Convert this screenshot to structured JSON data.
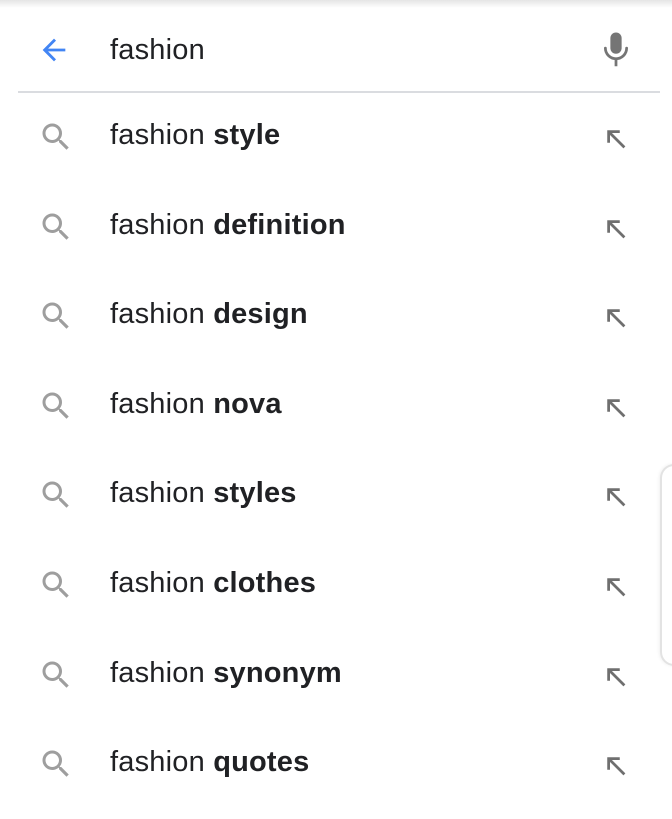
{
  "search": {
    "query": "fashion"
  },
  "icons": {
    "back": "arrow-back-icon",
    "mic": "mic-icon",
    "search": "search-icon",
    "fill": "arrow-up-left-icon"
  },
  "colors": {
    "accent": "#4285f4",
    "icon_gray": "#757575",
    "text": "#202124",
    "divider": "#dadce0"
  },
  "suggestions": [
    {
      "prefix": "fashion",
      "completion": "style"
    },
    {
      "prefix": "fashion",
      "completion": "definition"
    },
    {
      "prefix": "fashion",
      "completion": "design"
    },
    {
      "prefix": "fashion",
      "completion": "nova"
    },
    {
      "prefix": "fashion",
      "completion": "styles"
    },
    {
      "prefix": "fashion",
      "completion": "clothes"
    },
    {
      "prefix": "fashion",
      "completion": "synonym"
    },
    {
      "prefix": "fashion",
      "completion": "quotes"
    }
  ]
}
